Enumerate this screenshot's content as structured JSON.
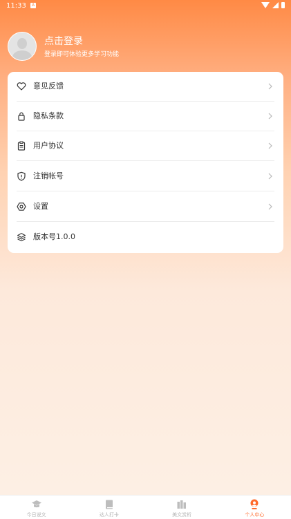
{
  "status_bar": {
    "time": "11:33",
    "app_badge": "A"
  },
  "profile": {
    "title": "点击登录",
    "subtitle": "登录即可体验更多学习功能"
  },
  "menu": {
    "items": [
      {
        "label": "意见反馈",
        "icon": "heart-icon",
        "has_arrow": true
      },
      {
        "label": "隐私条款",
        "icon": "lock-icon",
        "has_arrow": true
      },
      {
        "label": "用户协议",
        "icon": "clipboard-icon",
        "has_arrow": true
      },
      {
        "label": "注销帐号",
        "icon": "shield-icon",
        "has_arrow": true
      },
      {
        "label": "设置",
        "icon": "settings-hexagon-icon",
        "has_arrow": true
      },
      {
        "label": "版本号1.0.0",
        "icon": "layers-icon",
        "has_arrow": false
      }
    ]
  },
  "tabbar": {
    "tabs": [
      {
        "label": "今日说文",
        "icon": "graduation-cap-icon",
        "active": false
      },
      {
        "label": "达人打卡",
        "icon": "book-icon",
        "active": false
      },
      {
        "label": "美文赏析",
        "icon": "books-icon",
        "active": false
      },
      {
        "label": "个人中心",
        "icon": "person-icon",
        "active": true
      }
    ]
  },
  "colors": {
    "accent": "#ff6a2b",
    "header_gradient_top": "#ff8a45",
    "background_bottom": "#fdf0e5",
    "tab_inactive": "#b5b5b5"
  }
}
